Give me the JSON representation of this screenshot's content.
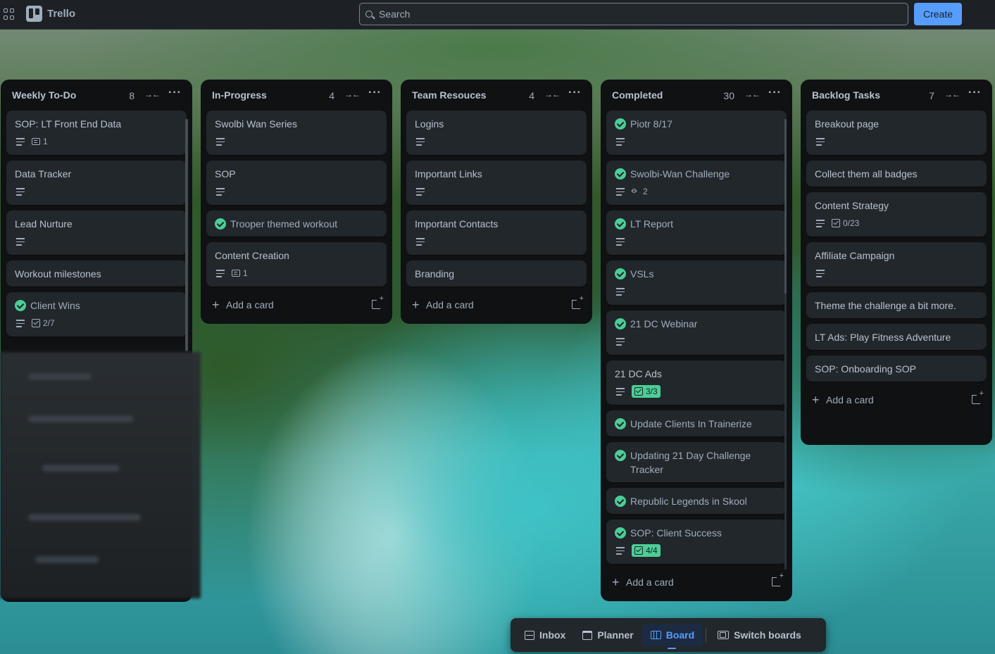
{
  "app": {
    "name": "Trello"
  },
  "topbar": {
    "search_placeholder": "Search",
    "create_label": "Create"
  },
  "colors": {
    "accent": "#579dff",
    "done": "#4bce97",
    "list_bg": "#101204",
    "card_bg": "#22272b"
  },
  "lists": [
    {
      "title": "Weekly To-Do",
      "count": "8",
      "cards": [
        {
          "title": "SOP: LT Front End Data",
          "done": false,
          "desc": true,
          "comments": "1"
        },
        {
          "title": "Data Tracker",
          "done": false,
          "desc": true
        },
        {
          "title": "Lead Nurture",
          "done": false,
          "desc": true
        },
        {
          "title": "Workout milestones",
          "done": false,
          "desc": false
        },
        {
          "title": "Client Wins",
          "done": true,
          "desc": true,
          "checklist": "2/7"
        }
      ]
    },
    {
      "title": "In-Progress",
      "count": "4",
      "cards": [
        {
          "title": "Swolbi Wan Series",
          "done": false,
          "desc": true
        },
        {
          "title": "SOP",
          "done": false,
          "desc": true
        },
        {
          "title": "Trooper themed workout",
          "done": true,
          "desc": false
        },
        {
          "title": "Content Creation",
          "done": false,
          "desc": true,
          "comments": "1"
        }
      ],
      "add_label": "Add a card"
    },
    {
      "title": "Team Resouces",
      "count": "4",
      "cards": [
        {
          "title": "Logins",
          "done": false,
          "desc": true
        },
        {
          "title": "Important Links",
          "done": false,
          "desc": true
        },
        {
          "title": "Important Contacts",
          "done": false,
          "desc": true
        },
        {
          "title": "Branding",
          "done": false,
          "desc": false
        }
      ],
      "add_label": "Add a card"
    },
    {
      "title": "Completed",
      "count": "30",
      "cards": [
        {
          "title": "Piotr 8/17",
          "done": true,
          "desc": true
        },
        {
          "title": "Swolbi-Wan Challenge",
          "done": true,
          "desc": true,
          "attachments": "2"
        },
        {
          "title": "LT Report",
          "done": true,
          "desc": true
        },
        {
          "title": "VSLs",
          "done": true,
          "desc": true
        },
        {
          "title": "21 DC Webinar",
          "done": true,
          "desc": true
        },
        {
          "title": "21 DC Ads",
          "done": false,
          "desc": true,
          "checklist": "3/3",
          "checklist_complete": true
        },
        {
          "title": "Update Clients In Trainerize",
          "done": true,
          "desc": false
        },
        {
          "title": "Updating 21 Day Challenge Tracker",
          "done": true,
          "desc": false
        },
        {
          "title": "Republic Legends in Skool",
          "done": true,
          "desc": false
        },
        {
          "title": "SOP: Client Success",
          "done": true,
          "desc": true,
          "checklist": "4/4",
          "checklist_complete": true
        }
      ],
      "add_label": "Add a card"
    },
    {
      "title": "Backlog Tasks",
      "count": "7",
      "cards": [
        {
          "title": "Breakout page",
          "done": false,
          "desc": true
        },
        {
          "title": "Collect them all badges",
          "done": false,
          "desc": false
        },
        {
          "title": "Content Strategy",
          "done": false,
          "desc": true,
          "checklist": "0/23"
        },
        {
          "title": "Affiliate Campaign",
          "done": false,
          "desc": true
        },
        {
          "title": "Theme the challenge a bit more.",
          "done": false,
          "desc": false
        },
        {
          "title": "LT Ads: Play Fitness Adventure",
          "done": false,
          "desc": false
        },
        {
          "title": "SOP: Onboarding SOP",
          "done": false,
          "desc": false
        }
      ],
      "add_label": "Add a card"
    }
  ],
  "bottom_nav": {
    "inbox": "Inbox",
    "planner": "Planner",
    "board": "Board",
    "switch": "Switch boards"
  }
}
